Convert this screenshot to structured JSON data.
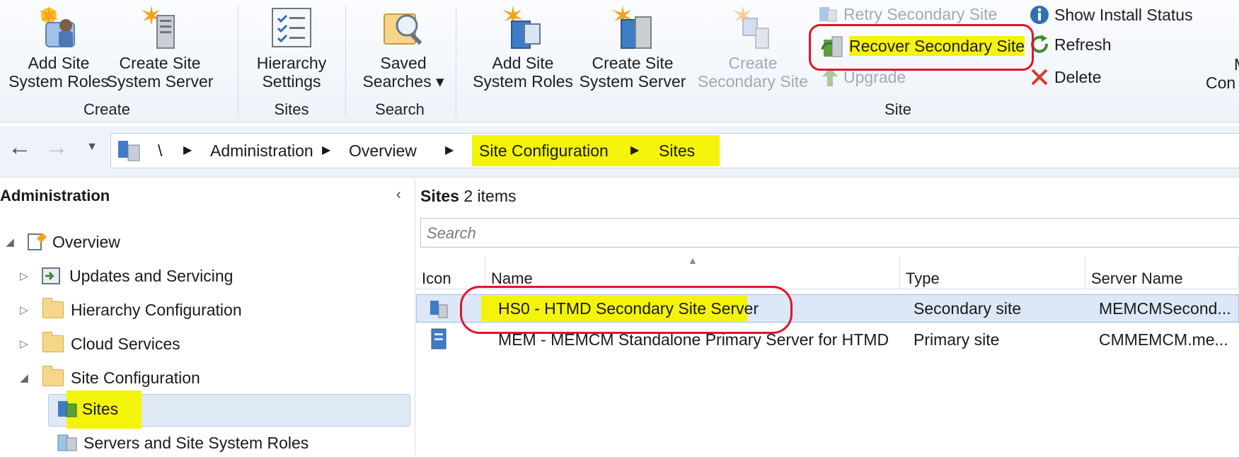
{
  "ribbon": {
    "groups": [
      {
        "label": "Create"
      },
      {
        "label": "Sites"
      },
      {
        "label": "Search"
      },
      {
        "label": "Site"
      }
    ],
    "buttons": {
      "add_site_roles_1": "Add Site\nSystem Roles",
      "create_site_server_1": "Create Site\nSystem Server",
      "hierarchy_settings": "Hierarchy\nSettings",
      "saved_searches": "Saved\nSearches ▾",
      "add_site_roles_2": "Add Site\nSystem Roles",
      "create_site_server_2": "Create Site\nSystem Server",
      "create_secondary_site": "Create\nSecondary Site",
      "retry_secondary_site": "Retry Secondary Site",
      "recover_secondary_site": "Recover Secondary Site",
      "upgrade": "Upgrade",
      "show_install_status": "Show Install Status",
      "refresh": "Refresh",
      "delete": "Delete",
      "cut_off_m": "M",
      "cut_off_con": "Con"
    }
  },
  "address_bar": {
    "root": "\\",
    "crumbs": [
      "Administration",
      "Overview",
      "Site Configuration",
      "Sites"
    ]
  },
  "tree": {
    "header": "Administration",
    "collapse_glyph": "‹",
    "items": [
      {
        "label": "Overview"
      },
      {
        "label": "Updates and Servicing"
      },
      {
        "label": "Hierarchy Configuration"
      },
      {
        "label": "Cloud Services"
      },
      {
        "label": "Site Configuration"
      },
      {
        "label": "Sites"
      },
      {
        "label": "Servers and Site System Roles"
      }
    ]
  },
  "list": {
    "title_main": "Sites",
    "title_count": "2 items",
    "search_placeholder": "Search",
    "columns": [
      "Icon",
      "Name",
      "Type",
      "Server Name"
    ],
    "rows": [
      {
        "name": "HS0 - HTMD Secondary Site Server",
        "type": "Secondary site",
        "server": "MEMCMSecond..."
      },
      {
        "name": "MEM - MEMCM Standalone Primary Server for HTMD",
        "type": "Primary site",
        "server": "CMMEMCM.me..."
      }
    ]
  },
  "colors": {
    "highlight": "#f4f30a",
    "annotation_red": "#e3132b",
    "selection": "#dce8f7"
  }
}
